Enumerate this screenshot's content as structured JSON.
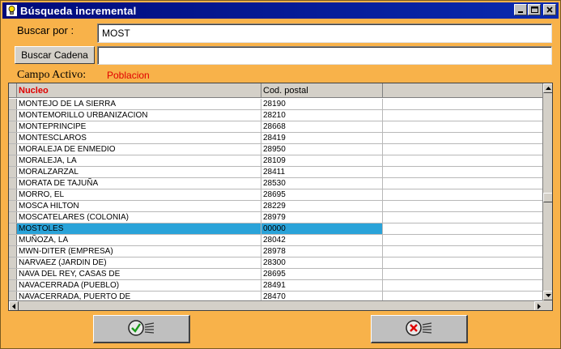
{
  "window": {
    "title": "Búsqueda incremental",
    "controls": [
      "_",
      "□",
      "✕"
    ]
  },
  "search": {
    "label": "Buscar por :",
    "value": "MOST",
    "cadena_button": "Buscar Cadena",
    "cadena_value": ""
  },
  "campo": {
    "label": "Campo Activo:",
    "value": "Poblacion"
  },
  "grid": {
    "headers": [
      "Nucleo",
      "Cod. postal",
      ""
    ],
    "rows": [
      [
        "MONTEJO DE LA SIERRA",
        "28190"
      ],
      [
        "MONTEMORILLO URBANIZACION",
        "28210"
      ],
      [
        "MONTEPRINCIPE",
        "28668"
      ],
      [
        "MONTESCLAROS",
        "28419"
      ],
      [
        "MORALEJA DE ENMEDIO",
        "28950"
      ],
      [
        "MORALEJA, LA",
        "28109"
      ],
      [
        "MORALZARZAL",
        "28411"
      ],
      [
        "MORATA DE TAJUÑA",
        "28530"
      ],
      [
        "MORRO, EL",
        "28695"
      ],
      [
        "MOSCA HILTON",
        "28229"
      ],
      [
        "MOSCATELARES (COLONIA)",
        "28979"
      ],
      [
        "MOSTOLES",
        "00000"
      ],
      [
        "MUÑOZA, LA",
        "28042"
      ],
      [
        "MWN-DITER (EMPRESA)",
        "28978"
      ],
      [
        "NARVAEZ (JARDIN DE)",
        "28300"
      ],
      [
        "NAVA DEL REY, CASAS DE",
        "28695"
      ],
      [
        "NAVACERRADA (PUEBLO)",
        "28491"
      ],
      [
        "NAVACERRADA, PUERTO DE",
        "28470"
      ]
    ],
    "selected_index": 11
  },
  "buttons": {
    "ok_icon": "check-icon",
    "cancel_icon": "cancel-icon"
  },
  "colors": {
    "window_bg": "#f8b24a",
    "title_bar": "#000a7a",
    "selection": "#2aa3d9",
    "header_accent": "#e00000"
  }
}
